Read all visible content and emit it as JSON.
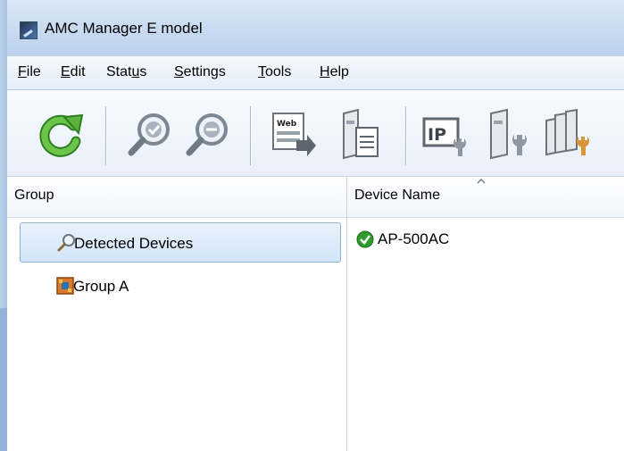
{
  "window": {
    "title": "AMC Manager E model"
  },
  "menu": [
    {
      "pre": "",
      "u": "F",
      "post": "ile"
    },
    {
      "pre": "",
      "u": "E",
      "post": "dit"
    },
    {
      "pre": "Stat",
      "u": "u",
      "post": "s"
    },
    {
      "pre": "",
      "u": "S",
      "post": "ettings"
    },
    {
      "pre": "",
      "u": "T",
      "post": "ools"
    },
    {
      "pre": "",
      "u": "H",
      "post": "elp"
    }
  ],
  "toolbar": {
    "web_icon_text": "Web",
    "ip_icon_text": "IP"
  },
  "left_panel": {
    "header": "Group",
    "items": [
      {
        "label": "Detected Devices",
        "icon": "magnifier-icon",
        "selected": true
      },
      {
        "label": "Group A",
        "icon": "group-icon",
        "selected": false
      }
    ]
  },
  "right_panel": {
    "header": "Device Name",
    "devices": [
      {
        "name": "AP-500AC",
        "status": "ok"
      }
    ]
  },
  "colors": {
    "title_bg": "#c7daf0",
    "selected_bg": "#d2e5fa",
    "refresh_green": "#3a9a2a",
    "status_ok": "#2e9a2e"
  }
}
